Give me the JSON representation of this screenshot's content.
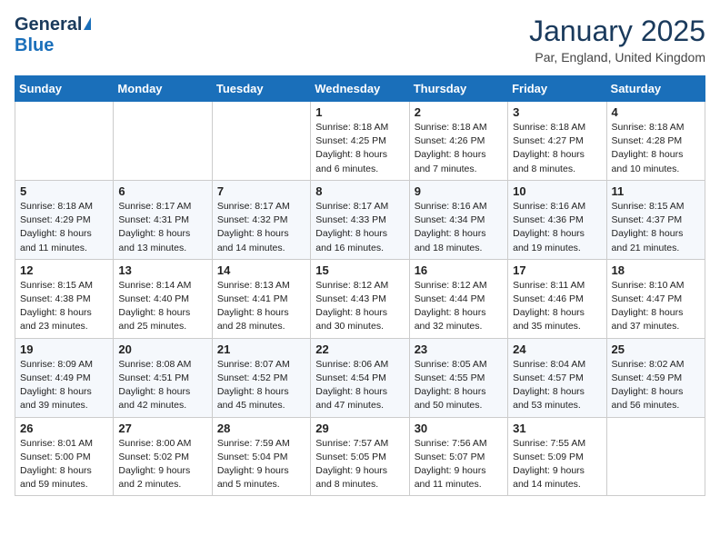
{
  "header": {
    "logo_general": "General",
    "logo_blue": "Blue",
    "month": "January 2025",
    "location": "Par, England, United Kingdom"
  },
  "weekdays": [
    "Sunday",
    "Monday",
    "Tuesday",
    "Wednesday",
    "Thursday",
    "Friday",
    "Saturday"
  ],
  "weeks": [
    [
      {
        "day": "",
        "sunrise": "",
        "sunset": "",
        "daylight": ""
      },
      {
        "day": "",
        "sunrise": "",
        "sunset": "",
        "daylight": ""
      },
      {
        "day": "",
        "sunrise": "",
        "sunset": "",
        "daylight": ""
      },
      {
        "day": "1",
        "sunrise": "Sunrise: 8:18 AM",
        "sunset": "Sunset: 4:25 PM",
        "daylight": "Daylight: 8 hours and 6 minutes."
      },
      {
        "day": "2",
        "sunrise": "Sunrise: 8:18 AM",
        "sunset": "Sunset: 4:26 PM",
        "daylight": "Daylight: 8 hours and 7 minutes."
      },
      {
        "day": "3",
        "sunrise": "Sunrise: 8:18 AM",
        "sunset": "Sunset: 4:27 PM",
        "daylight": "Daylight: 8 hours and 8 minutes."
      },
      {
        "day": "4",
        "sunrise": "Sunrise: 8:18 AM",
        "sunset": "Sunset: 4:28 PM",
        "daylight": "Daylight: 8 hours and 10 minutes."
      }
    ],
    [
      {
        "day": "5",
        "sunrise": "Sunrise: 8:18 AM",
        "sunset": "Sunset: 4:29 PM",
        "daylight": "Daylight: 8 hours and 11 minutes."
      },
      {
        "day": "6",
        "sunrise": "Sunrise: 8:17 AM",
        "sunset": "Sunset: 4:31 PM",
        "daylight": "Daylight: 8 hours and 13 minutes."
      },
      {
        "day": "7",
        "sunrise": "Sunrise: 8:17 AM",
        "sunset": "Sunset: 4:32 PM",
        "daylight": "Daylight: 8 hours and 14 minutes."
      },
      {
        "day": "8",
        "sunrise": "Sunrise: 8:17 AM",
        "sunset": "Sunset: 4:33 PM",
        "daylight": "Daylight: 8 hours and 16 minutes."
      },
      {
        "day": "9",
        "sunrise": "Sunrise: 8:16 AM",
        "sunset": "Sunset: 4:34 PM",
        "daylight": "Daylight: 8 hours and 18 minutes."
      },
      {
        "day": "10",
        "sunrise": "Sunrise: 8:16 AM",
        "sunset": "Sunset: 4:36 PM",
        "daylight": "Daylight: 8 hours and 19 minutes."
      },
      {
        "day": "11",
        "sunrise": "Sunrise: 8:15 AM",
        "sunset": "Sunset: 4:37 PM",
        "daylight": "Daylight: 8 hours and 21 minutes."
      }
    ],
    [
      {
        "day": "12",
        "sunrise": "Sunrise: 8:15 AM",
        "sunset": "Sunset: 4:38 PM",
        "daylight": "Daylight: 8 hours and 23 minutes."
      },
      {
        "day": "13",
        "sunrise": "Sunrise: 8:14 AM",
        "sunset": "Sunset: 4:40 PM",
        "daylight": "Daylight: 8 hours and 25 minutes."
      },
      {
        "day": "14",
        "sunrise": "Sunrise: 8:13 AM",
        "sunset": "Sunset: 4:41 PM",
        "daylight": "Daylight: 8 hours and 28 minutes."
      },
      {
        "day": "15",
        "sunrise": "Sunrise: 8:12 AM",
        "sunset": "Sunset: 4:43 PM",
        "daylight": "Daylight: 8 hours and 30 minutes."
      },
      {
        "day": "16",
        "sunrise": "Sunrise: 8:12 AM",
        "sunset": "Sunset: 4:44 PM",
        "daylight": "Daylight: 8 hours and 32 minutes."
      },
      {
        "day": "17",
        "sunrise": "Sunrise: 8:11 AM",
        "sunset": "Sunset: 4:46 PM",
        "daylight": "Daylight: 8 hours and 35 minutes."
      },
      {
        "day": "18",
        "sunrise": "Sunrise: 8:10 AM",
        "sunset": "Sunset: 4:47 PM",
        "daylight": "Daylight: 8 hours and 37 minutes."
      }
    ],
    [
      {
        "day": "19",
        "sunrise": "Sunrise: 8:09 AM",
        "sunset": "Sunset: 4:49 PM",
        "daylight": "Daylight: 8 hours and 39 minutes."
      },
      {
        "day": "20",
        "sunrise": "Sunrise: 8:08 AM",
        "sunset": "Sunset: 4:51 PM",
        "daylight": "Daylight: 8 hours and 42 minutes."
      },
      {
        "day": "21",
        "sunrise": "Sunrise: 8:07 AM",
        "sunset": "Sunset: 4:52 PM",
        "daylight": "Daylight: 8 hours and 45 minutes."
      },
      {
        "day": "22",
        "sunrise": "Sunrise: 8:06 AM",
        "sunset": "Sunset: 4:54 PM",
        "daylight": "Daylight: 8 hours and 47 minutes."
      },
      {
        "day": "23",
        "sunrise": "Sunrise: 8:05 AM",
        "sunset": "Sunset: 4:55 PM",
        "daylight": "Daylight: 8 hours and 50 minutes."
      },
      {
        "day": "24",
        "sunrise": "Sunrise: 8:04 AM",
        "sunset": "Sunset: 4:57 PM",
        "daylight": "Daylight: 8 hours and 53 minutes."
      },
      {
        "day": "25",
        "sunrise": "Sunrise: 8:02 AM",
        "sunset": "Sunset: 4:59 PM",
        "daylight": "Daylight: 8 hours and 56 minutes."
      }
    ],
    [
      {
        "day": "26",
        "sunrise": "Sunrise: 8:01 AM",
        "sunset": "Sunset: 5:00 PM",
        "daylight": "Daylight: 8 hours and 59 minutes."
      },
      {
        "day": "27",
        "sunrise": "Sunrise: 8:00 AM",
        "sunset": "Sunset: 5:02 PM",
        "daylight": "Daylight: 9 hours and 2 minutes."
      },
      {
        "day": "28",
        "sunrise": "Sunrise: 7:59 AM",
        "sunset": "Sunset: 5:04 PM",
        "daylight": "Daylight: 9 hours and 5 minutes."
      },
      {
        "day": "29",
        "sunrise": "Sunrise: 7:57 AM",
        "sunset": "Sunset: 5:05 PM",
        "daylight": "Daylight: 9 hours and 8 minutes."
      },
      {
        "day": "30",
        "sunrise": "Sunrise: 7:56 AM",
        "sunset": "Sunset: 5:07 PM",
        "daylight": "Daylight: 9 hours and 11 minutes."
      },
      {
        "day": "31",
        "sunrise": "Sunrise: 7:55 AM",
        "sunset": "Sunset: 5:09 PM",
        "daylight": "Daylight: 9 hours and 14 minutes."
      },
      {
        "day": "",
        "sunrise": "",
        "sunset": "",
        "daylight": ""
      }
    ]
  ]
}
